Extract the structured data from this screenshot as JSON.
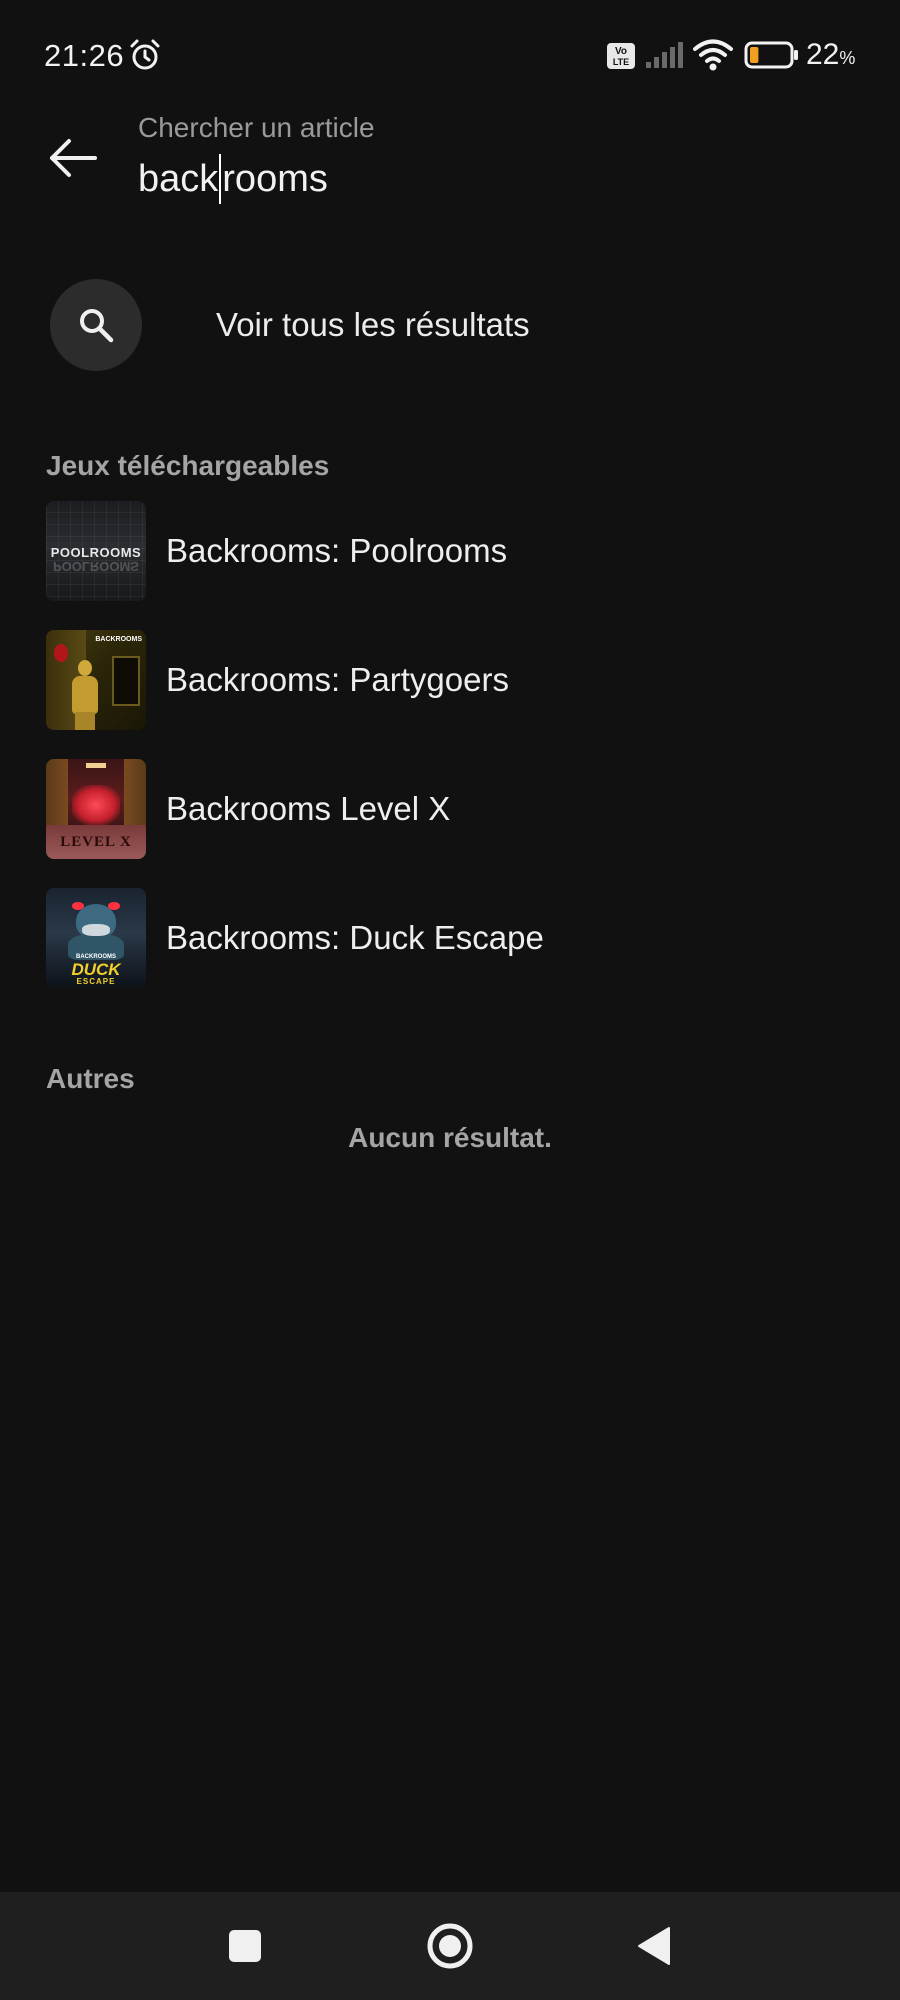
{
  "status_bar": {
    "time": "21:26",
    "battery_percent": "22",
    "battery_unit": "%",
    "battery_level": 0.22,
    "icons": [
      "alarm-icon",
      "volte-icon",
      "signal-icon",
      "wifi-icon",
      "battery-icon"
    ]
  },
  "search": {
    "placeholder": "Chercher un article",
    "query_before_caret": "back",
    "query_after_caret": "rooms"
  },
  "see_all": {
    "label": "Voir tous les résultats",
    "icon": "search-icon"
  },
  "sections": {
    "games_title": "Jeux téléchargeables",
    "others_title": "Autres",
    "no_results": "Aucun résultat."
  },
  "games": [
    {
      "title": "Backrooms: Poolrooms",
      "thumb_text": "POOLROOMS"
    },
    {
      "title": "Backrooms: Partygoers",
      "thumb_text": "BACKROOMS"
    },
    {
      "title": "Backrooms Level X",
      "thumb_text": "LEVEL X"
    },
    {
      "title": "Backrooms: Duck Escape",
      "thumb_text": "BACKROOMS",
      "thumb_text2": "DUCK",
      "thumb_text3": "ESCAPE"
    }
  ],
  "nav_bar": {
    "icons": [
      "recents-square-icon",
      "home-circle-icon",
      "back-triangle-icon"
    ]
  },
  "colors": {
    "background": "#111111",
    "nav_background": "#1f1f1f",
    "battery_fill": "#f0a020",
    "muted_text": "#a5a5a5"
  }
}
